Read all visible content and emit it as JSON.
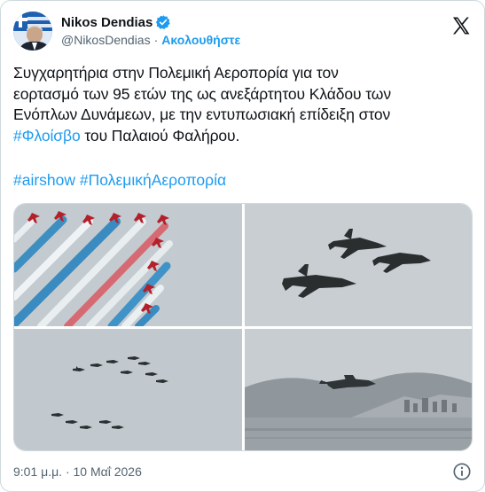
{
  "author": {
    "name": "Nikos Dendias",
    "handle": "@NikosDendias",
    "separator": "·",
    "follow_label": "Ακολουθήστε"
  },
  "tweet": {
    "text_line1": "Συγχαρητήρια στην Πολεμική Αεροπορία για τον",
    "text_line2": "εορτασμό των 95 ετών της ως ανεξάρτητου Κλάδου των",
    "text_line3": "Ενόπλων Δυνάμεων, με την εντυπωσιακή επίδειξη στον",
    "hashtag_inline": "#Φλοίσβο",
    "text_line4_rest": " του Παλαιού Φαλήρου.",
    "hashtag1": "#airshow",
    "hashtag2": "#ΠολεμικήΑεροπορία"
  },
  "timestamp": "9:01 μ.μ. · 10 Μαΐ 2026",
  "icons": {
    "logo": "x-logo-icon",
    "verified": "verified-badge-icon",
    "info": "info-icon"
  },
  "colors": {
    "link": "#1d9bf0",
    "text": "#0f1419",
    "secondary": "#536471",
    "border": "#cfd9de"
  }
}
